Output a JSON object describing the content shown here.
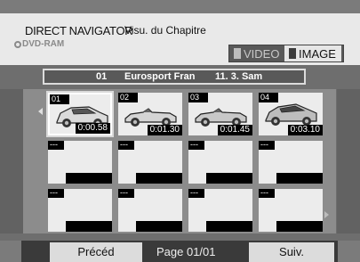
{
  "header": {
    "title": "DIRECT NAVIGATOR",
    "subtitle": "Visu. du Chapitre",
    "media": "DVD-RAM"
  },
  "modes": {
    "video": "VIDEO",
    "image": "IMAGE",
    "active": "IMAGE"
  },
  "info": {
    "number": "01",
    "channel": "Eurosport Fran",
    "date": "11. 3. Sam"
  },
  "chapters": [
    {
      "num": "01",
      "time": "0:00.58",
      "image": "car-hatchback",
      "selected": true
    },
    {
      "num": "02",
      "time": "0:01.30",
      "image": "car-convertible"
    },
    {
      "num": "03",
      "time": "0:01.45",
      "image": "car-convertible"
    },
    {
      "num": "04",
      "time": "0:03.10",
      "image": "car-hatchback"
    }
  ],
  "empty_label": "---",
  "footer": {
    "prev": "Précéd",
    "page": "Page 01/01",
    "next": "Suiv."
  },
  "colors": {
    "background": "#6e6e6e",
    "header": "#e9e9e9",
    "tile": "#ececec",
    "grid": "#8c8c8c",
    "button": "#dcdcdc"
  }
}
